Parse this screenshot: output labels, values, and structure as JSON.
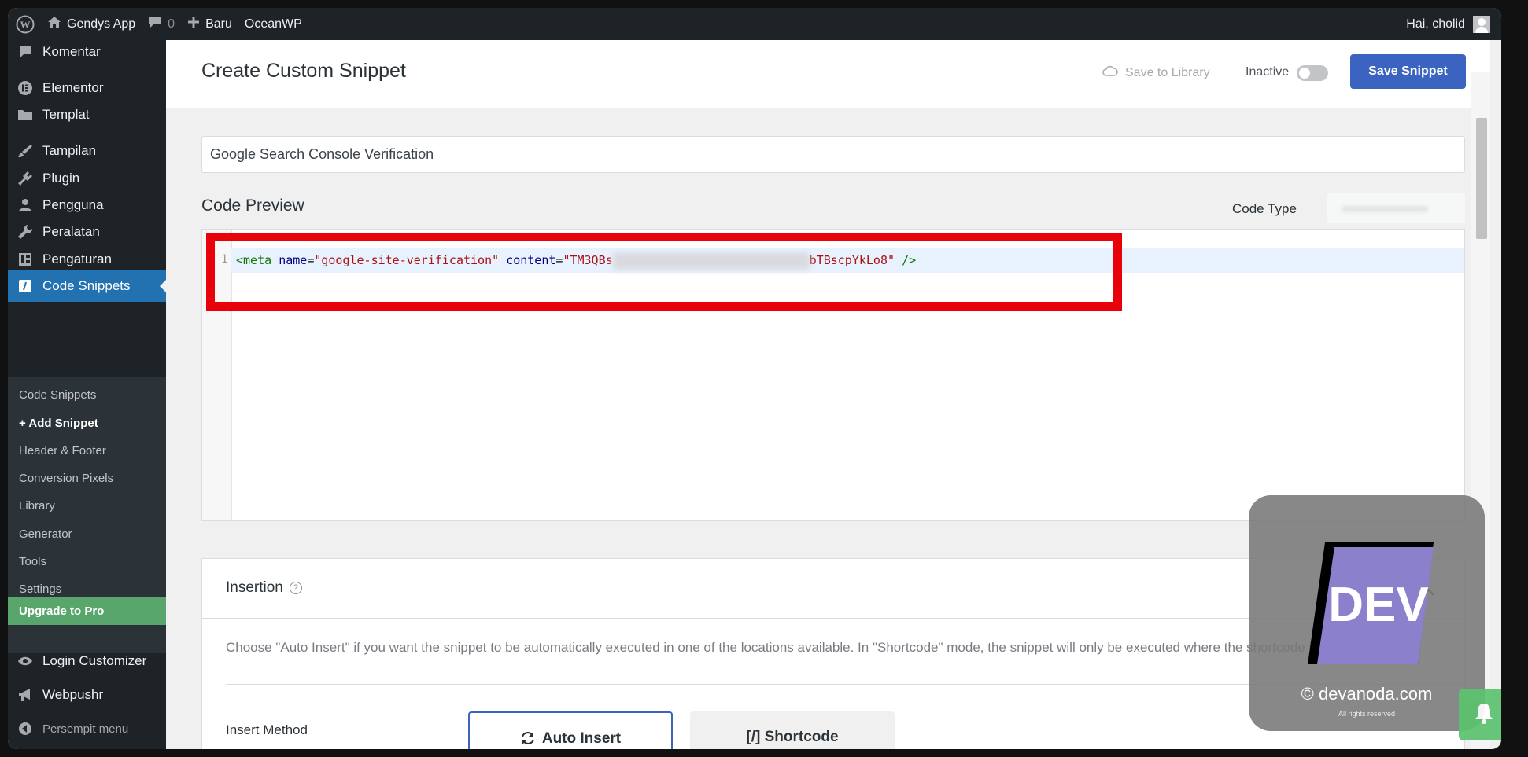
{
  "adminbar": {
    "site_name": "Gendys App",
    "comments_count": "0",
    "new_label": "Baru",
    "theme_link": "OceanWP",
    "greeting": "Hai, cholid"
  },
  "sidebar": {
    "items": [
      {
        "label": "Komentar",
        "icon": "comment-icon"
      },
      {
        "label": "Elementor",
        "icon": "elementor-icon"
      },
      {
        "label": "Templat",
        "icon": "folder-icon"
      },
      {
        "label": "Tampilan",
        "icon": "brush-icon"
      },
      {
        "label": "Plugin",
        "icon": "plugin-icon"
      },
      {
        "label": "Pengguna",
        "icon": "user-icon"
      },
      {
        "label": "Peralatan",
        "icon": "wrench-icon"
      },
      {
        "label": "Pengaturan",
        "icon": "settings-icon"
      },
      {
        "label": "Code Snippets",
        "icon": "code-icon"
      }
    ],
    "submenu": [
      "Code Snippets",
      "+ Add Snippet",
      "Header & Footer",
      "Conversion Pixels",
      "Library",
      "Generator",
      "Tools",
      "Settings",
      "Upgrade to Pro"
    ],
    "bottom_items": [
      {
        "label": "Login Customizer",
        "icon": "eye-icon"
      },
      {
        "label": "Webpushr",
        "icon": "megaphone-icon"
      },
      {
        "label": "Persempit menu",
        "icon": "collapse-icon"
      }
    ]
  },
  "header": {
    "title": "Create Custom Snippet",
    "save_to_library": "Save to Library",
    "status_label": "Inactive",
    "active": false,
    "save_button": "Save Snippet"
  },
  "snippet": {
    "title_value": "Google Search Console Verification",
    "code_preview_label": "Code Preview",
    "code_type_label": "Code Type",
    "line_number": "1",
    "code": {
      "open": "<meta",
      "attr1": "name",
      "val1": "\"google-site-verification\"",
      "attr2": "content",
      "val2_start": "\"TM3QBs",
      "val2_end": "bTBscpYkLo8\"",
      "close": "/>"
    }
  },
  "insertion": {
    "title": "Insertion",
    "description": "Choose \"Auto Insert\" if you want the snippet to be automatically executed in one of the locations available. In \"Shortcode\" mode, the snippet will only be executed where the shortcode is inserted.",
    "insert_method_label": "Insert Method",
    "auto_insert": "Auto Insert",
    "shortcode": "[/] Shortcode"
  },
  "watermark": {
    "logo_text": "DEV",
    "site": "© devanoda.com",
    "rights": "All rights reserved"
  },
  "colors": {
    "admin_dark": "#1d2327",
    "accent_blue": "#2271b1",
    "button_blue": "#3a64c0",
    "upgrade_green": "#59a66c",
    "highlight_red": "#e8000b"
  }
}
